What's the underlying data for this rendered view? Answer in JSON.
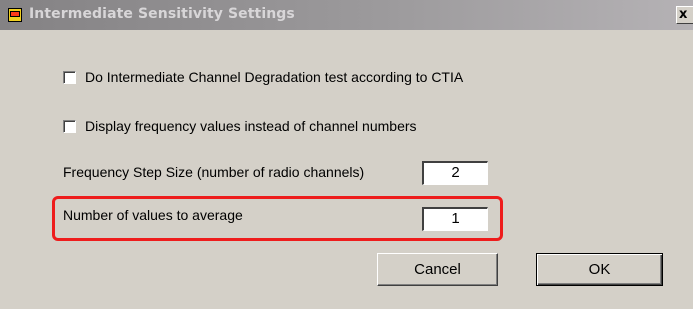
{
  "window": {
    "title": "Intermediate Sensitivity Settings",
    "close_glyph": "x",
    "icon": "app-icon"
  },
  "options": {
    "ctia_label": "Do Intermediate Channel Degradation test according to CTIA",
    "ctia_checked": false,
    "freq_label": "Display frequency values instead of channel numbers",
    "freq_checked": false
  },
  "fields": {
    "step_label": "Frequency Step Size (number of radio channels)",
    "step_value": "2",
    "average_label": "Number of values to average",
    "average_value": "1"
  },
  "buttons": {
    "cancel_label": "Cancel",
    "ok_label": "OK"
  },
  "highlight_color": "#ee1c1c"
}
